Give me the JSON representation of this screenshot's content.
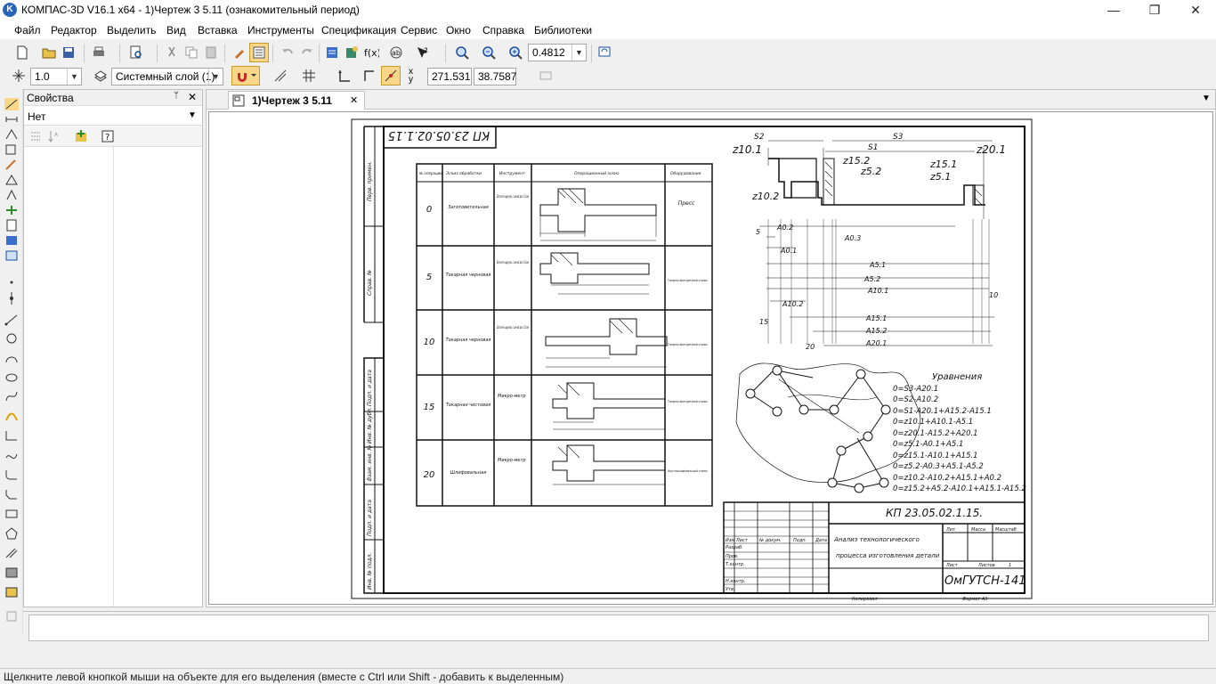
{
  "app": {
    "title": "КОМПАС-3D V16.1 x64 - 1)Чертеж 3 5.11 (ознакомительный период)",
    "icon_letter": "K"
  },
  "window_controls": {
    "minimize": "—",
    "maximize": "❐",
    "close": "✕"
  },
  "menu": [
    "Файл",
    "Редактор",
    "Выделить",
    "Вид",
    "Вставка",
    "Инструменты",
    "Спецификация",
    "Сервис",
    "Окно",
    "Справка",
    "Библиотеки"
  ],
  "toolbar1": {
    "zoom_value": "0.4812"
  },
  "toolbar2": {
    "step_value": "1.0",
    "layer_value": "Системный слой (1)",
    "coord_x": "271.531",
    "coord_y": "38.7587"
  },
  "properties": {
    "title": "Свойства",
    "selector_value": "Нет"
  },
  "document_tab": {
    "label": "1)Чертеж 3 5.11",
    "close": "✕"
  },
  "status": {
    "hint": "Щелкните левой кнопкой мыши на объекте для его выделения (вместе с Ctrl или Shift - добавить к выделенным)"
  },
  "drawing": {
    "corner_code": "КП 23.05.02.1.15",
    "table_headers": [
      "№ операции",
      "Эскиз обработки",
      "Инструмент",
      "Операционный эскиз",
      "Оборудование"
    ],
    "operations": [
      {
        "num": "0",
        "name": "Заготовительная",
        "tool": "Штанген-циркуль с ценой дел. 0,1мм",
        "equip": "Пресс"
      },
      {
        "num": "5",
        "name": "Токарная черновая",
        "tool": "Штанген-циркуль с ценой дел. 0,1мм",
        "equip": "Токарно-винторезный станок"
      },
      {
        "num": "10",
        "name": "Токарная черновая",
        "tool": "Штанген-циркуль с ценой дел. 0,1мм",
        "equip": "Токарно-винторезный станок"
      },
      {
        "num": "15",
        "name": "Токарная чистовая",
        "tool": "Микро-метр",
        "equip": "Токарно-винторезный станок"
      },
      {
        "num": "20",
        "name": "Шлифовальная",
        "tool": "Микро-метр",
        "equip": "Круглошлифовальный станок"
      }
    ],
    "size_labels": [
      "S2",
      "S3",
      "S1",
      "z10.1",
      "z20.1",
      "z15.2",
      "z5.2",
      "z15.1",
      "z5.1",
      "z10.2",
      "A0.2",
      "A0.3",
      "A0.1",
      "A5.1",
      "A5.2",
      "A10.1",
      "A10.2",
      "A15.1",
      "A15.2",
      "A20.1"
    ],
    "row_labels": [
      "5",
      "10",
      "15",
      "20"
    ],
    "equations_title": "Уравнения",
    "equations": [
      "0=S3-A20.1",
      "0=S2-A10.2",
      "0=S1-A20.1+A15.2-A15.1",
      "0=z10.1+A10.1-A5.1",
      "0=z20.1-A15.2+A20.1",
      "0=z5.1-A0.1+A5.1",
      "0=z15.1-A10.1+A15.1",
      "0=z5.2-A0.3+A5.1-A5.2",
      "0=z10.2-A10.2+A15.1+A0.2",
      "0=z15.2+A5.2-A10.1+A15.1-A15.2"
    ],
    "stamp": {
      "code": "КП 23.05.02.1.15.",
      "title_line1": "Анализ технологического",
      "title_line2": "процесса изготовления детали",
      "org": "ОмГУТСН-141",
      "cols": [
        "Лит.",
        "Масса",
        "Масштаб"
      ],
      "sheet": "Лист",
      "sheets": "Листов",
      "sheets_count": "1",
      "rows": [
        "Изм",
        "Разраб.",
        "Пров.",
        "Т.контр.",
        "Н.контр.",
        "Утв."
      ],
      "hdr": [
        "Лист",
        "№ докум.",
        "Подп.",
        "Дата"
      ],
      "copied": "Копировал",
      "format": "Формат A3"
    },
    "side_labels": [
      "Перв. примен.",
      "Справ. №",
      "Подп. и дата",
      "Инв. № дубл.",
      "Взам. инв. №",
      "Подп. и дата",
      "Инв. № подл."
    ]
  }
}
